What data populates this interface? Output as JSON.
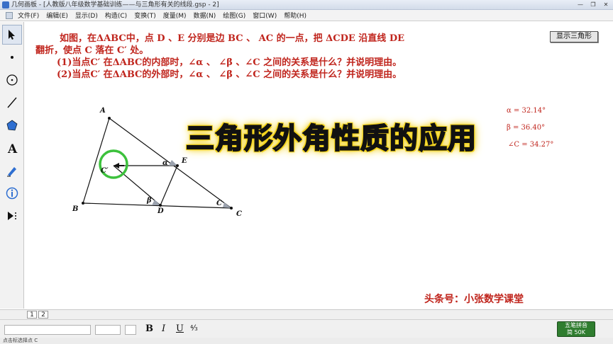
{
  "window": {
    "title": "几何画板 - [人教版八年级数学基础训练——与三角形有关的线段.gsp - 2]",
    "controls": [
      "—",
      "❐",
      "✕"
    ]
  },
  "menu": [
    "文件(F)",
    "编辑(E)",
    "显示(D)",
    "构造(C)",
    "变换(T)",
    "度量(M)",
    "数据(N)",
    "绘图(G)",
    "窗口(W)",
    "帮助(H)"
  ],
  "toolbar": [
    "arrow-icon",
    "point-icon",
    "compass-icon",
    "line-icon",
    "polygon-icon",
    "text-icon",
    "marker-icon",
    "info-icon",
    "custom-tool-icon"
  ],
  "problem": {
    "line1": "如图，在ΔABC中，点 D 、E 分别是边 BC 、 AC 的一点，把 ΔCDE 沿直线 DE",
    "line2": "翻折，使点 C  落在 C′ 处。",
    "line3": "(1)当点C′ 在ΔABC的内部时，∠α 、 ∠β 、∠C 之间的关系是什么？并说明理由。",
    "line4": "(2)当点C′ 在ΔABC的外部时，∠α 、 ∠β 、∠C 之间的关系是什么？并说明理由。"
  },
  "show_button": "显示三角形",
  "overlay_title": "三角形外角性质的应用",
  "measurements": {
    "alpha": "α = 32.14°",
    "beta": "β = 36.40°",
    "angle_c": "∠C = 34.27°"
  },
  "figure_labels": {
    "A": "A",
    "B": "B",
    "C": "C",
    "D": "D",
    "E": "E",
    "C_prime": "C′",
    "alpha": "α",
    "beta": "β",
    "c_small": "C"
  },
  "watermark": "头条号：小张数学课堂",
  "pages": [
    "1",
    "2"
  ],
  "format": {
    "bold": "B",
    "italic": "I",
    "underline": "U",
    "fraction": "⁴⁄₃"
  },
  "ime": {
    "line1": "五笔拼音",
    "line2": "简 50K"
  },
  "status": "点击标选择点 C",
  "colors": {
    "text_red": "#c0251d",
    "highlight_circle": "#3cc13c",
    "title_glow": "#f2d21b"
  }
}
